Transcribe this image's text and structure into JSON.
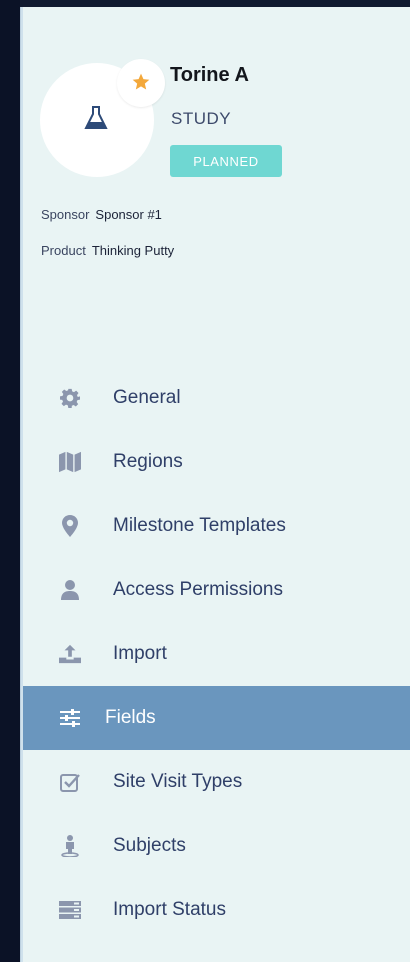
{
  "study": {
    "name": "Torine A",
    "type": "STUDY",
    "status": "PLANNED",
    "sponsor_label": "Sponsor",
    "sponsor_value": "Sponsor #1",
    "product_label": "Product",
    "product_value": "Thinking Putty"
  },
  "icons": {
    "avatar": "flask-icon",
    "favorite": "star-icon"
  },
  "colors": {
    "sidebar_bg": "#e9f4f4",
    "active_bg": "#6a96be",
    "status_badge": "#6fd7d2",
    "star": "#f3a83b",
    "nav_text": "#2f3f68",
    "icon": "#8b96ad"
  },
  "nav": {
    "active": "Fields",
    "items": [
      {
        "label": "General",
        "icon": "gear-icon"
      },
      {
        "label": "Regions",
        "icon": "map-icon"
      },
      {
        "label": "Milestone Templates",
        "icon": "map-pin-icon"
      },
      {
        "label": "Access Permissions",
        "icon": "user-icon"
      },
      {
        "label": "Import",
        "icon": "upload-icon"
      },
      {
        "label": "Fields",
        "icon": "sliders-icon"
      },
      {
        "label": "Site Visit Types",
        "icon": "checkbox-icon"
      },
      {
        "label": "Subjects",
        "icon": "person-pin-icon"
      },
      {
        "label": "Import Status",
        "icon": "server-icon"
      }
    ]
  }
}
